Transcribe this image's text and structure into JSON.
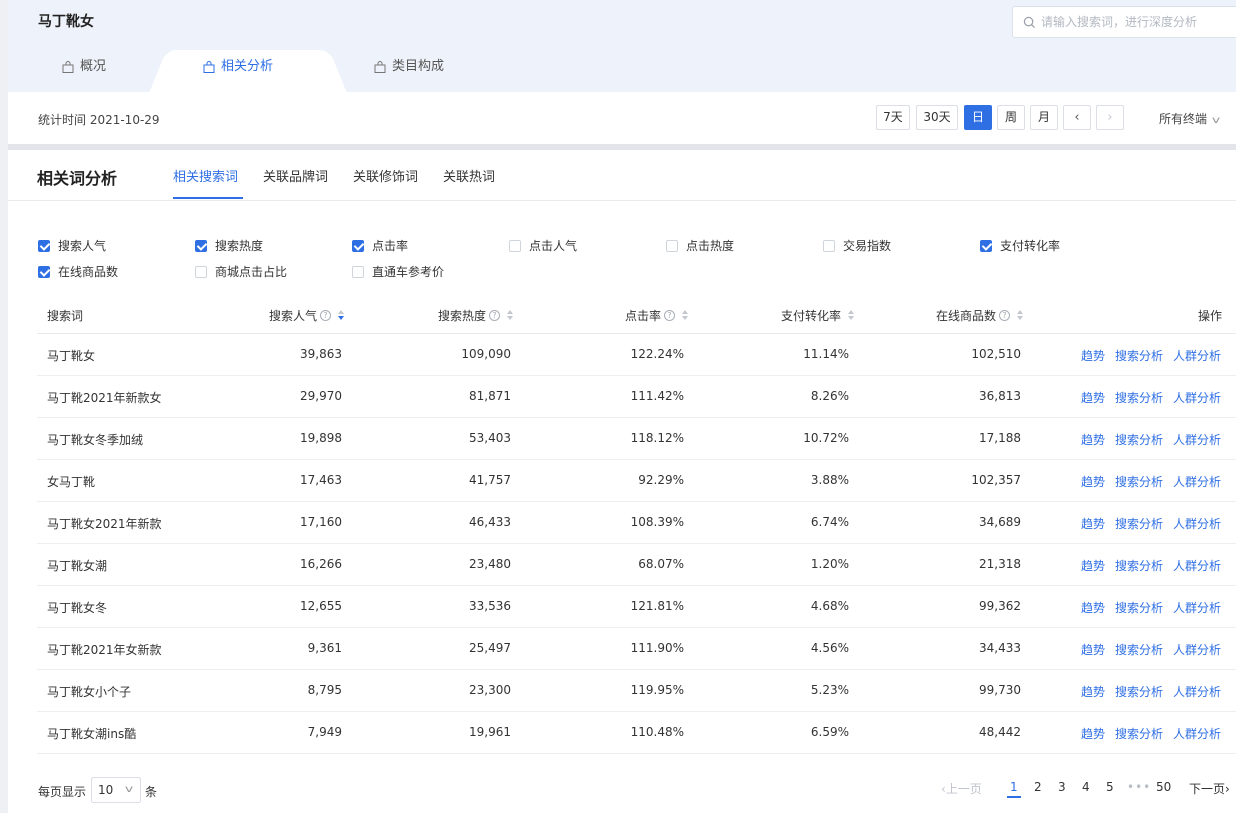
{
  "header": {
    "title": "马丁靴女",
    "search_placeholder": "请输入搜索词，进行深度分析",
    "tabs": [
      {
        "label": "概况"
      },
      {
        "label": "相关分析"
      },
      {
        "label": "类目构成"
      }
    ]
  },
  "timebar": {
    "stat_time": "统计时间 2021-10-29",
    "periods": [
      "7天",
      "30天",
      "日",
      "周",
      "月"
    ],
    "active_period": "日",
    "prev": "‹",
    "next": "›",
    "terminal": "所有终端"
  },
  "section": {
    "title": "相关词分析",
    "subtabs": [
      "相关搜索词",
      "关联品牌词",
      "关联修饰词",
      "关联热词"
    ]
  },
  "metrics": [
    {
      "label": "搜索人气",
      "checked": true
    },
    {
      "label": "搜索热度",
      "checked": true
    },
    {
      "label": "点击率",
      "checked": true
    },
    {
      "label": "点击人气",
      "checked": false
    },
    {
      "label": "点击热度",
      "checked": false
    },
    {
      "label": "交易指数",
      "checked": false
    },
    {
      "label": "支付转化率",
      "checked": true
    },
    {
      "label": "在线商品数",
      "checked": true
    },
    {
      "label": "商城点击占比",
      "checked": false
    },
    {
      "label": "直通车参考价",
      "checked": false
    }
  ],
  "table": {
    "columns": [
      "搜索词",
      "搜索人气",
      "搜索热度",
      "点击率",
      "支付转化率",
      "在线商品数",
      "操作"
    ],
    "actions": [
      "趋势",
      "搜索分析",
      "人群分析"
    ],
    "rows": [
      [
        "马丁靴女",
        "39,863",
        "109,090",
        "122.24%",
        "11.14%",
        "102,510"
      ],
      [
        "马丁靴2021年新款女",
        "29,970",
        "81,871",
        "111.42%",
        "8.26%",
        "36,813"
      ],
      [
        "马丁靴女冬季加绒",
        "19,898",
        "53,403",
        "118.12%",
        "10.72%",
        "17,188"
      ],
      [
        "女马丁靴",
        "17,463",
        "41,757",
        "92.29%",
        "3.88%",
        "102,357"
      ],
      [
        "马丁靴女2021年新款",
        "17,160",
        "46,433",
        "108.39%",
        "6.74%",
        "34,689"
      ],
      [
        "马丁靴女潮",
        "16,266",
        "23,480",
        "68.07%",
        "1.20%",
        "21,318"
      ],
      [
        "马丁靴女冬",
        "12,655",
        "33,536",
        "121.81%",
        "4.68%",
        "99,362"
      ],
      [
        "马丁靴2021年女新款",
        "9,361",
        "25,497",
        "111.90%",
        "4.56%",
        "34,433"
      ],
      [
        "马丁靴女小个子",
        "8,795",
        "23,300",
        "119.95%",
        "5.23%",
        "99,730"
      ],
      [
        "马丁靴女潮ins酷",
        "7,949",
        "19,961",
        "110.48%",
        "6.59%",
        "48,442"
      ]
    ]
  },
  "pagination": {
    "per_page_label": "每页显示",
    "per_page_value": "10",
    "per_page_unit": "条",
    "prev": "上一页",
    "next": "下一页",
    "pages": [
      "1",
      "2",
      "3",
      "4",
      "5"
    ],
    "ellipsis": "•••",
    "last": "50",
    "current": "1"
  },
  "colors": {
    "accent": "#2f6fe4"
  }
}
